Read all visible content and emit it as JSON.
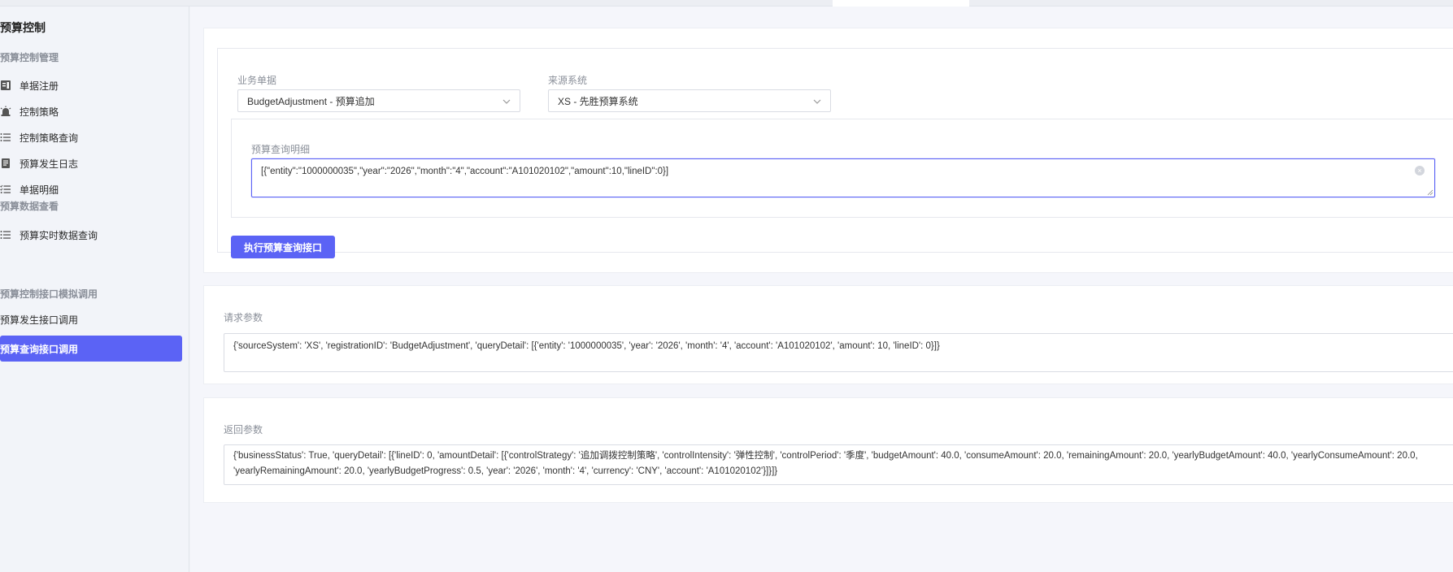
{
  "sidebar": {
    "title": "预算控制",
    "sections": [
      {
        "title": "预算控制管理"
      },
      {
        "title": "预算数据查看"
      },
      {
        "title": "预算控制接口模拟调用"
      }
    ],
    "items": [
      {
        "label": "单据注册",
        "icon": "document-register-icon"
      },
      {
        "label": "控制策略",
        "icon": "alarm-light-icon"
      },
      {
        "label": "控制策略查询",
        "icon": "list-icon"
      },
      {
        "label": "预算发生日志",
        "icon": "log-book-icon"
      },
      {
        "label": "单据明细",
        "icon": "checklist-icon"
      },
      {
        "label": "预算实时数据查询",
        "icon": "list-icon"
      },
      {
        "label": "预算发生接口调用",
        "icon": ""
      },
      {
        "label": "预算查询接口调用",
        "icon": "",
        "active": true
      }
    ]
  },
  "form": {
    "business_doc_label": "业务单据",
    "business_doc_value": "BudgetAdjustment - 预算追加",
    "source_system_label": "来源系统",
    "source_system_value": "XS - 先胜预算系统",
    "query_detail_label": "预算查询明细",
    "query_detail_value": "[{\"entity\":\"1000000035\",\"year\":\"2026\",\"month\":\"4\",\"account\":\"A101020102\",\"amount\":10,\"lineID\":0}]",
    "run_button_label": "执行预算查询接口"
  },
  "request": {
    "label": "请求参数",
    "value": "{'sourceSystem': 'XS', 'registrationID': 'BudgetAdjustment', 'queryDetail': [{'entity': '1000000035', 'year': '2026', 'month': '4', 'account': 'A101020102', 'amount': 10, 'lineID': 0}]}"
  },
  "response": {
    "label": "返回参数",
    "value": "{'businessStatus': True, 'queryDetail': [{'lineID': 0, 'amountDetail': [{'controlStrategy': '追加调拨控制策略', 'controlIntensity': '弹性控制', 'controlPeriod': '季度', 'budgetAmount': 40.0, 'consumeAmount': 20.0, 'remainingAmount': 20.0, 'yearlyBudgetAmount': 40.0, 'yearlyConsumeAmount': 20.0, 'yearlyRemainingAmount': 20.0, 'yearlyBudgetProgress': 0.5, 'year': '2026', 'month': '4', 'currency': 'CNY', 'account': 'A101020102'}]}]}"
  },
  "colors": {
    "accent": "#5b63f5",
    "sidebar_bg": "#f2f4f9",
    "section_title": "#8a8f99"
  }
}
